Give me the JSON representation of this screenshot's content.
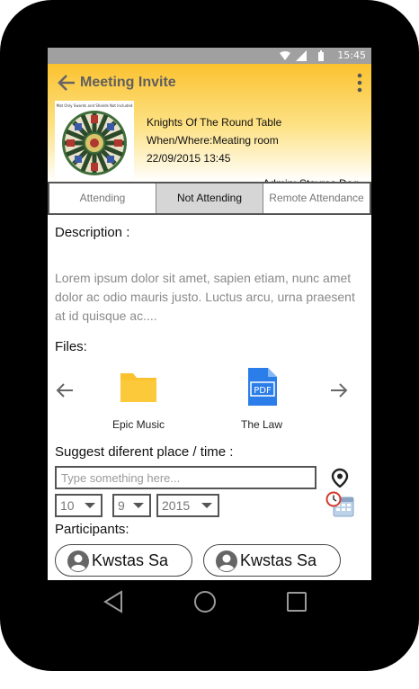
{
  "status_bar": {
    "time": "15:45",
    "icons": [
      "wifi-icon",
      "signal-icon",
      "battery-icon"
    ]
  },
  "header": {
    "title": "Meeting Invite",
    "seal_caption": "Mat Only Swords and Shields Not Included",
    "meeting_name": "Knights Of The Round Table",
    "where": "When/Where:Meating room",
    "date": "22/09/2015  13:45",
    "admin": "Admin: Stayros Dag"
  },
  "tabs": [
    {
      "label": "Attending",
      "active": false
    },
    {
      "label": "Not Attending",
      "active": true
    },
    {
      "label": "Remote Attendance",
      "active": false
    }
  ],
  "description": {
    "label": "Description :",
    "text": "Lorem ipsum dolor sit amet, sapien etiam, nunc amet dolor ac odio mauris justo. Luctus arcu, urna praesent at id quisque ac...."
  },
  "files": {
    "label": "Files:",
    "items": [
      {
        "name": "Epic Music",
        "icon": "folder-icon"
      },
      {
        "name": "The Law",
        "icon": "pdf-icon",
        "badge": "PDF"
      }
    ]
  },
  "suggest": {
    "label": "Suggest diferent place / time :",
    "placeholder": "Type something here...",
    "day": "10",
    "month": "9",
    "year": "2015"
  },
  "participants": {
    "label": "Participants:",
    "items": [
      "Kwstas Sa",
      "Kwstas Sa"
    ]
  },
  "colors": {
    "header_accent": "#fbc22f",
    "file_folder": "#fbc22f",
    "file_pdf": "#2b7de9"
  }
}
